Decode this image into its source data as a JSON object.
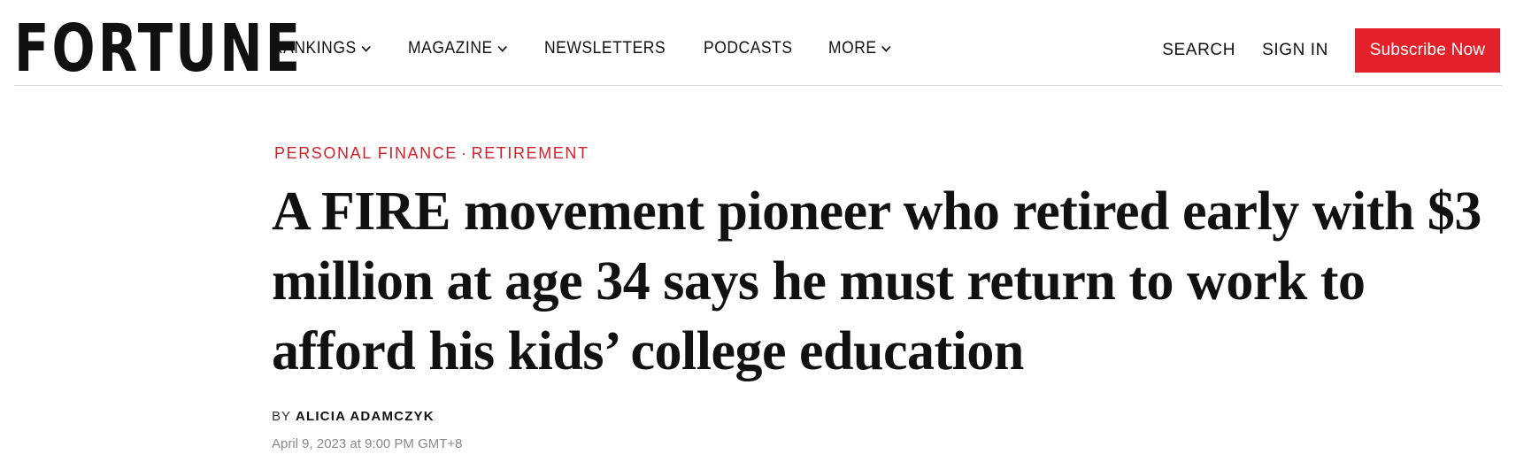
{
  "header": {
    "logo": "FORTUNE",
    "nav": [
      {
        "label": "RANKINGS",
        "has_dropdown": true
      },
      {
        "label": "MAGAZINE",
        "has_dropdown": true
      },
      {
        "label": "NEWSLETTERS",
        "has_dropdown": false
      },
      {
        "label": "PODCASTS",
        "has_dropdown": false
      },
      {
        "label": "MORE",
        "has_dropdown": true
      }
    ],
    "search_label": "SEARCH",
    "signin_label": "SIGN IN",
    "subscribe_label": "Subscribe Now"
  },
  "article": {
    "kicker": {
      "section": "PERSONAL FINANCE",
      "separator": "·",
      "subsection": "RETIREMENT"
    },
    "headline": "A FIRE movement pioneer who retired early with $3 million at age 34 says he must return to work to afford his kids’ college education",
    "byline_prefix": "BY",
    "author": "ALICIA ADAMCZYK",
    "date": "April 9, 2023 at 9:00 PM GMT+8"
  },
  "colors": {
    "accent": "#e4212a",
    "kicker": "#d41f2a",
    "text": "#111111",
    "muted": "#8a8a8a"
  },
  "icons": {
    "dropdown": "chevron-down-icon"
  }
}
